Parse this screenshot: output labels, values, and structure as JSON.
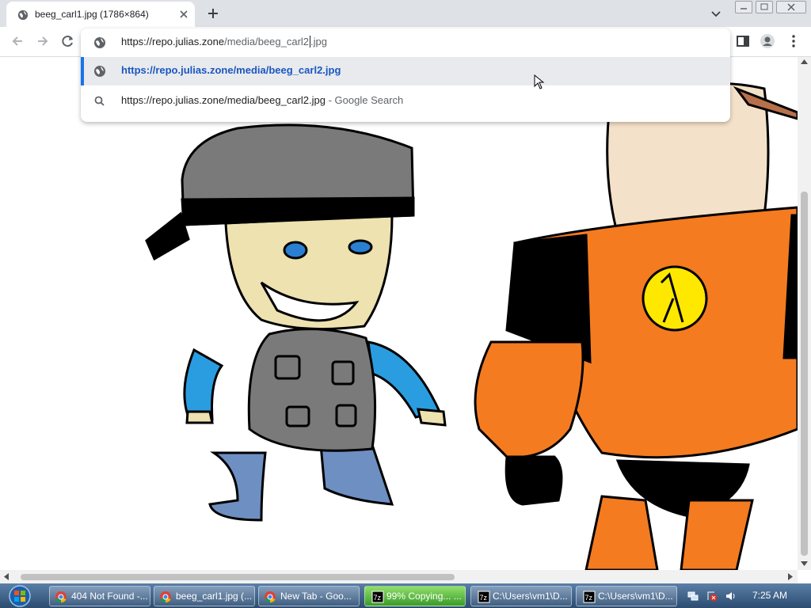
{
  "tab": {
    "title": "beeg_carl1.jpg (1786×864)"
  },
  "omnibox": {
    "input_host": "https://repo.julias.zone",
    "input_path": "/media/beeg_carl2",
    "input_ext": "jpg",
    "suggestion_url": "https://repo.julias.zone/media/beeg_carl2.jpg",
    "search_query": "https://repo.julias.zone/media/beeg_carl2.jpg",
    "search_suffix": " - Google Search"
  },
  "taskbar": {
    "items": [
      {
        "label": "404 Not Found -...",
        "icon": "chrome-icon"
      },
      {
        "label": "beeg_carl1.jpg (...",
        "icon": "chrome-icon"
      },
      {
        "label": "New Tab - Goo...",
        "icon": "chrome-icon"
      },
      {
        "label": "99% Copying... ...",
        "icon": "7zip-icon"
      },
      {
        "label": "C:\\Users\\vm1\\D...",
        "icon": "7zip-icon"
      },
      {
        "label": "C:\\Users\\vm1\\D...",
        "icon": "7zip-icon"
      }
    ],
    "clock": "7:25 AM"
  },
  "colors": {
    "accent": "#1a73e8",
    "copy_progress": "#4cbf38"
  }
}
